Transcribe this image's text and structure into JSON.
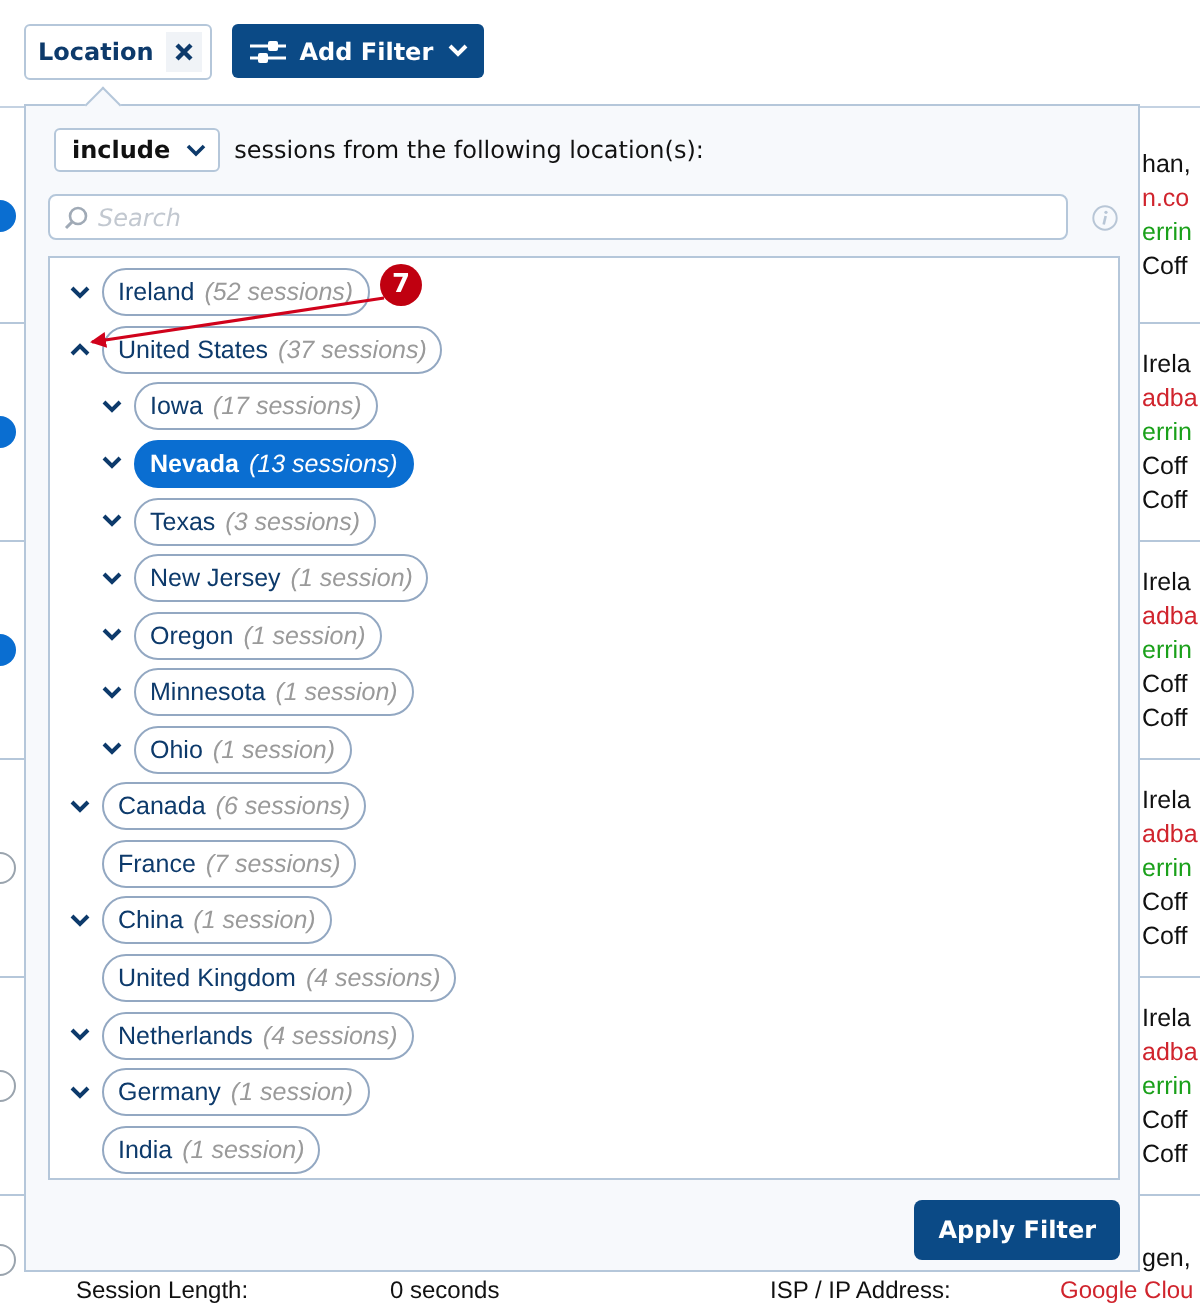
{
  "filter_bar": {
    "chip": {
      "label": "Location"
    },
    "add_button": {
      "label": "Add Filter"
    }
  },
  "background_list": {
    "rows": [
      {
        "kind": "filled",
        "lines": [
          {
            "text": "han,",
            "color": "#111111"
          },
          {
            "text": "n.co",
            "color": "#d0242d"
          },
          {
            "text": "errin",
            "color": "#1aa01a"
          },
          {
            "text": "Coff",
            "color": "#111111"
          }
        ]
      },
      {
        "kind": "filled",
        "lines": [
          {
            "text": "Irela",
            "color": "#111111"
          },
          {
            "text": "adba",
            "color": "#d0242d"
          },
          {
            "text": "errin",
            "color": "#1aa01a"
          },
          {
            "text": "Coff",
            "color": "#111111"
          },
          {
            "text": "Coff",
            "color": "#111111"
          }
        ]
      },
      {
        "kind": "filled",
        "lines": [
          {
            "text": "Irela",
            "color": "#111111"
          },
          {
            "text": "adba",
            "color": "#d0242d"
          },
          {
            "text": "errin",
            "color": "#1aa01a"
          },
          {
            "text": "Coff",
            "color": "#111111"
          },
          {
            "text": "Coff",
            "color": "#111111"
          }
        ]
      },
      {
        "kind": "outline",
        "lines": [
          {
            "text": "Irela",
            "color": "#111111"
          },
          {
            "text": "adba",
            "color": "#d0242d"
          },
          {
            "text": "errin",
            "color": "#1aa01a"
          },
          {
            "text": "Coff",
            "color": "#111111"
          },
          {
            "text": "Coff",
            "color": "#111111"
          }
        ]
      },
      {
        "kind": "outline",
        "lines": [
          {
            "text": "Irela",
            "color": "#111111"
          },
          {
            "text": "adba",
            "color": "#d0242d"
          },
          {
            "text": "errin",
            "color": "#1aa01a"
          },
          {
            "text": "Coff",
            "color": "#111111"
          },
          {
            "text": "Coff",
            "color": "#111111"
          }
        ]
      },
      {
        "kind": "outline",
        "lines": [
          {
            "text": "gen,",
            "color": "#111111"
          }
        ]
      }
    ],
    "footer_line": [
      {
        "text": "Session Length:",
        "color": "#111111"
      },
      {
        "text": "0 seconds",
        "color": "#111111"
      },
      {
        "text": "ISP / IP Address:",
        "color": "#111111"
      },
      {
        "text": "Google Clou",
        "color": "#d0242d"
      }
    ]
  },
  "popover": {
    "mode": "include",
    "sentence": "sessions from the following location(s):",
    "search": {
      "placeholder": "Search"
    },
    "tree": [
      {
        "label": "Ireland",
        "count": "(52 sessions)",
        "expandable": true,
        "expanded": false,
        "selected": false
      },
      {
        "label": "United States",
        "count": "(37 sessions)",
        "expandable": true,
        "expanded": true,
        "selected": false,
        "children": [
          {
            "label": "Iowa",
            "count": "(17 sessions)",
            "expandable": true,
            "expanded": false,
            "selected": false
          },
          {
            "label": "Nevada",
            "count": "(13 sessions)",
            "expandable": true,
            "expanded": false,
            "selected": true
          },
          {
            "label": "Texas",
            "count": "(3 sessions)",
            "expandable": true,
            "expanded": false,
            "selected": false
          },
          {
            "label": "New Jersey",
            "count": "(1 session)",
            "expandable": true,
            "expanded": false,
            "selected": false
          },
          {
            "label": "Oregon",
            "count": "(1 session)",
            "expandable": true,
            "expanded": false,
            "selected": false
          },
          {
            "label": "Minnesota",
            "count": "(1 session)",
            "expandable": true,
            "expanded": false,
            "selected": false
          },
          {
            "label": "Ohio",
            "count": "(1 session)",
            "expandable": true,
            "expanded": false,
            "selected": false
          }
        ]
      },
      {
        "label": "Canada",
        "count": "(6 sessions)",
        "expandable": true,
        "expanded": false,
        "selected": false
      },
      {
        "label": "France",
        "count": "(7 sessions)",
        "expandable": false,
        "selected": false
      },
      {
        "label": "China",
        "count": "(1 session)",
        "expandable": true,
        "expanded": false,
        "selected": false
      },
      {
        "label": "United Kingdom",
        "count": "(4 sessions)",
        "expandable": false,
        "selected": false
      },
      {
        "label": "Netherlands",
        "count": "(4 sessions)",
        "expandable": true,
        "expanded": false,
        "selected": false
      },
      {
        "label": "Germany",
        "count": "(1 session)",
        "expandable": true,
        "expanded": false,
        "selected": false
      },
      {
        "label": "India",
        "count": "(1 session)",
        "expandable": false,
        "selected": false
      }
    ],
    "apply_button": {
      "label": "Apply Filter"
    }
  },
  "annotation": {
    "number": "7"
  }
}
